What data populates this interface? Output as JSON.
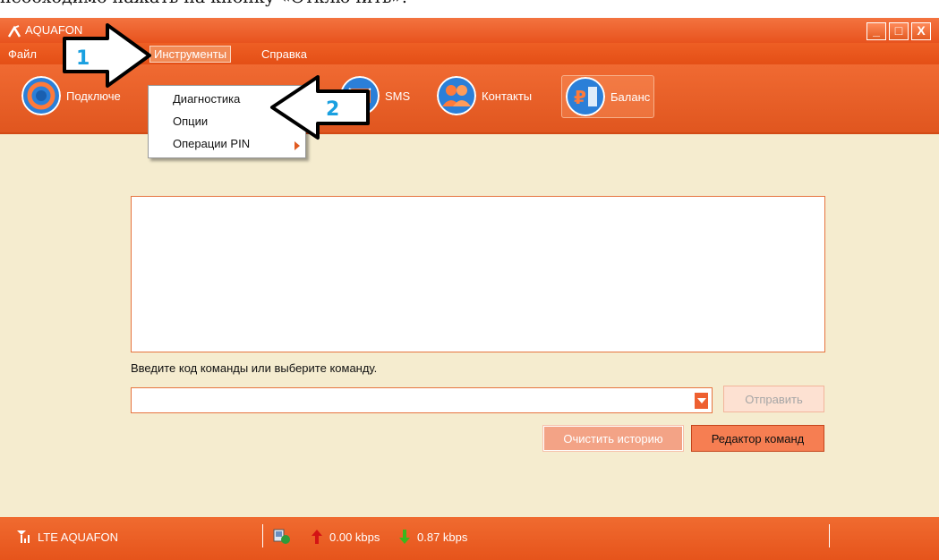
{
  "caption": "необходимо нажать на кнопку «Отключить».",
  "window": {
    "title": "AQUAFON",
    "minimize": "_",
    "maximize": "□",
    "close": "X"
  },
  "menu": {
    "file": "Файл",
    "tools": "Инструменты",
    "help": "Справка"
  },
  "toolbar": {
    "connect": "Подключе",
    "sms": "SMS",
    "contacts": "Контакты",
    "balance": "Баланс"
  },
  "dropdown": {
    "items": [
      "Диагностика",
      "Опции",
      "Операции PIN"
    ]
  },
  "callouts": {
    "one": "1",
    "two": "2"
  },
  "main": {
    "prompt": "Введите код команды или выберите команду.",
    "command_value": "",
    "send": "Отправить",
    "clear_history": "Очистить историю",
    "command_editor": "Редактор команд"
  },
  "status": {
    "network": "LTE  AQUAFON",
    "upload": "0.00 kbps",
    "download": "0.87 kbps"
  },
  "icons": {
    "signal": "signal-bars-icon",
    "connection": "network-connection-icon",
    "up": "upload-arrow-icon",
    "down": "download-arrow-icon"
  },
  "colors": {
    "accent": "#e8531e",
    "background": "#f5eccf",
    "callout_number": "#1aa0e0"
  }
}
